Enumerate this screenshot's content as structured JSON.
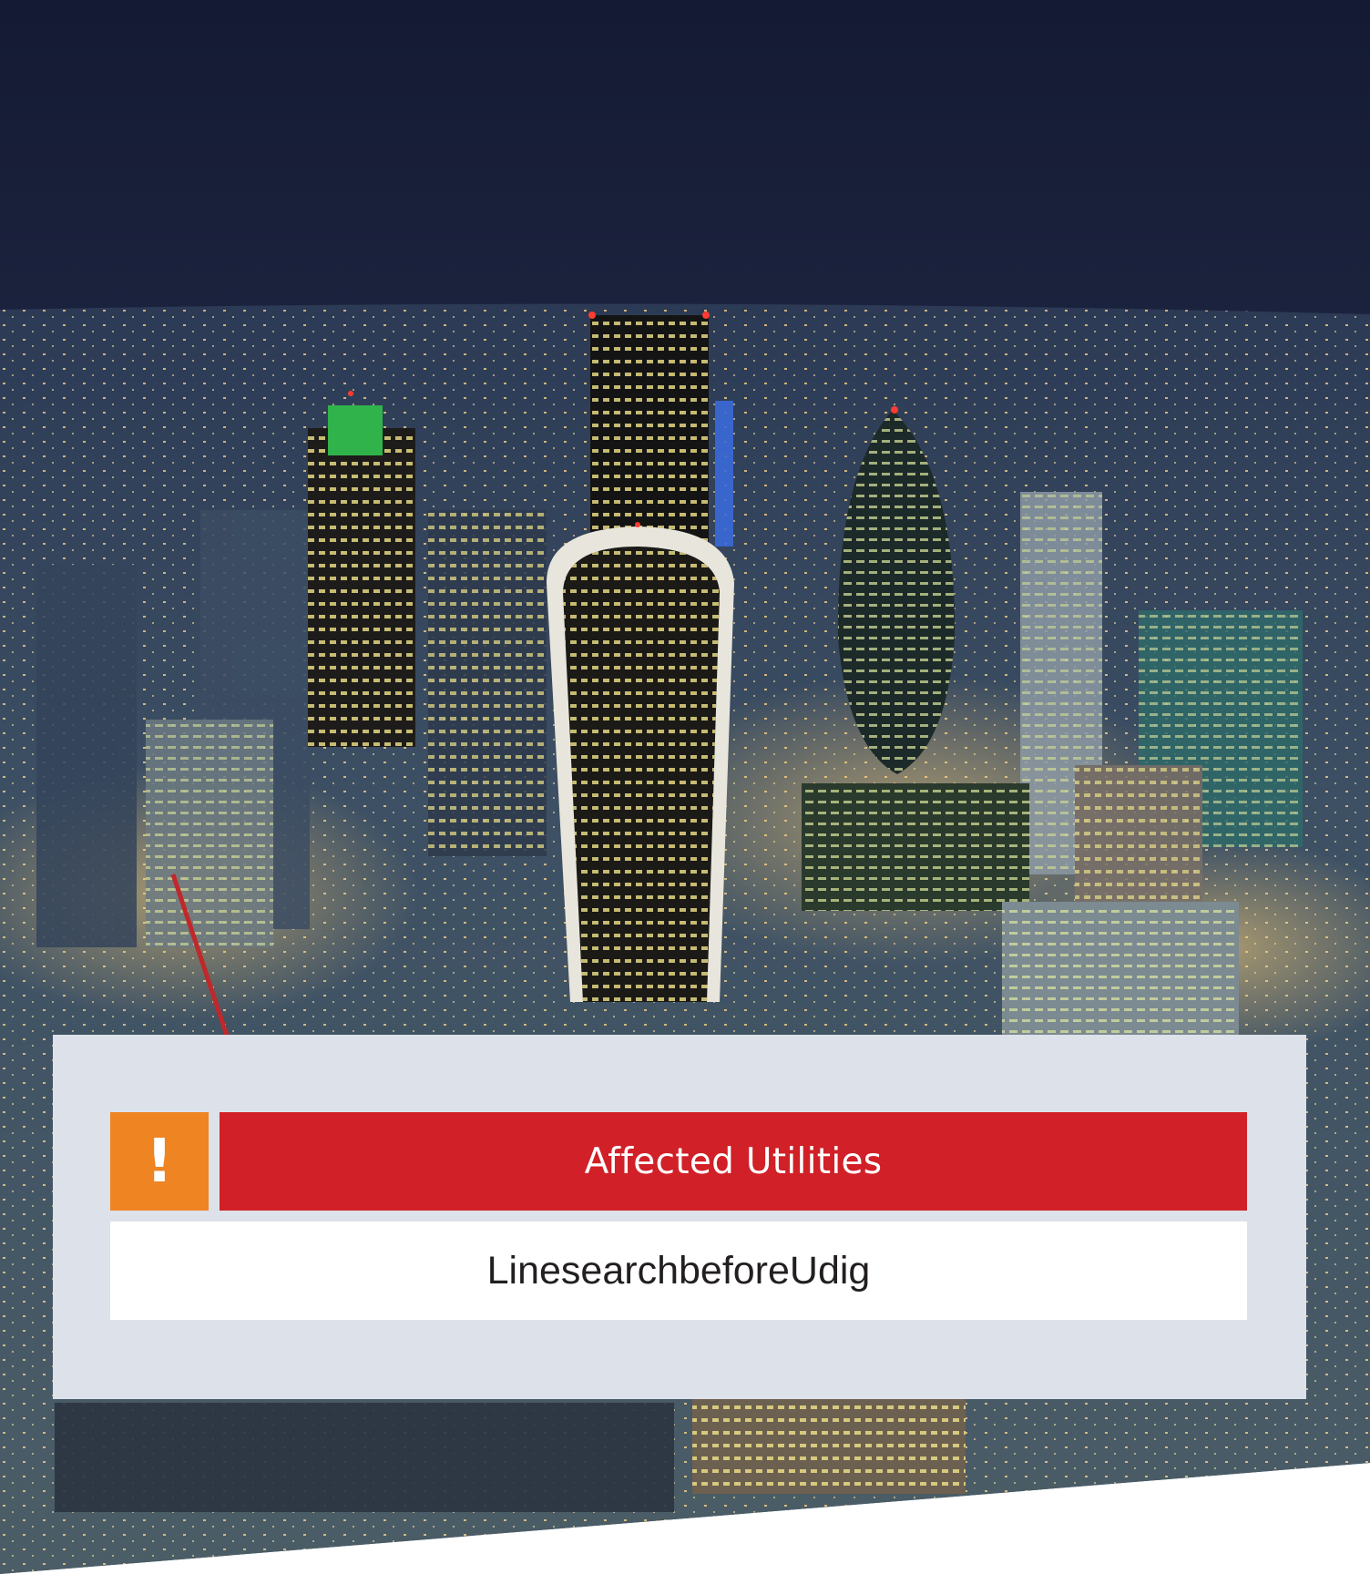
{
  "panel": {
    "icon": "exclamation-icon",
    "icon_glyph": "!",
    "title": "Affected Utilities",
    "value": "LinesearchbeforeUdig"
  },
  "colors": {
    "warning_orange": "#ee8422",
    "title_red": "#d12027",
    "panel_grey": "#dde1e9",
    "night_sky": "#1c2540"
  }
}
